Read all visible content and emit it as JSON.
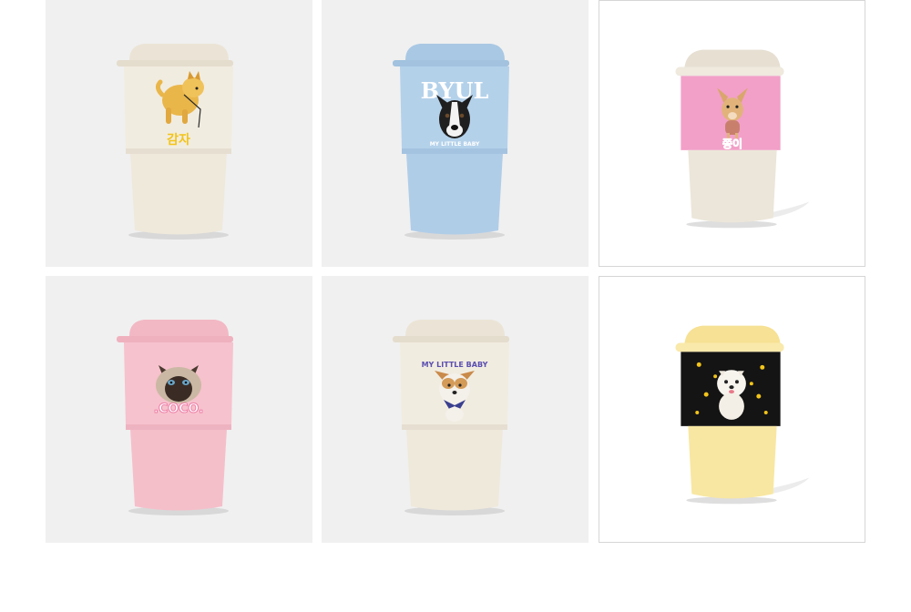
{
  "products": [
    {
      "id": 1,
      "cup_color": "#f1ece0",
      "lid_color": "#ebe4d6",
      "label": "감자",
      "label_color": "#f2c419",
      "pet": "shiba-dog"
    },
    {
      "id": 2,
      "cup_color": "#b4d1ea",
      "lid_color": "#a9c8e4",
      "label": "BYUL",
      "sublabel": "MY LITTLE BABY",
      "label_color": "#ffffff",
      "pet": "boston-terrier"
    },
    {
      "id": 3,
      "cup_color": "#ece6da",
      "lid_color": "#e6dfd2",
      "sleeve_color": "#f2a0c8",
      "label": "쫑이",
      "label_color": "#f04fa0",
      "pet": "chihuahua"
    },
    {
      "id": 4,
      "cup_color": "#f6c2cd",
      "lid_color": "#f2b8c4",
      "label": ".COCO.",
      "label_color": "#ffffff",
      "pet": "siamese-cat"
    },
    {
      "id": 5,
      "cup_color": "#f1ece0",
      "lid_color": "#ebe4d6",
      "label": "MY LITTLE BABY",
      "label_color": "#5b4fb0",
      "pet": "papillon"
    },
    {
      "id": 6,
      "cup_color": "#f8e7a2",
      "lid_color": "#f6e194",
      "sleeve_color": "#141414",
      "label": "",
      "pet": "pomeranian",
      "star_color": "#f2c419"
    }
  ]
}
